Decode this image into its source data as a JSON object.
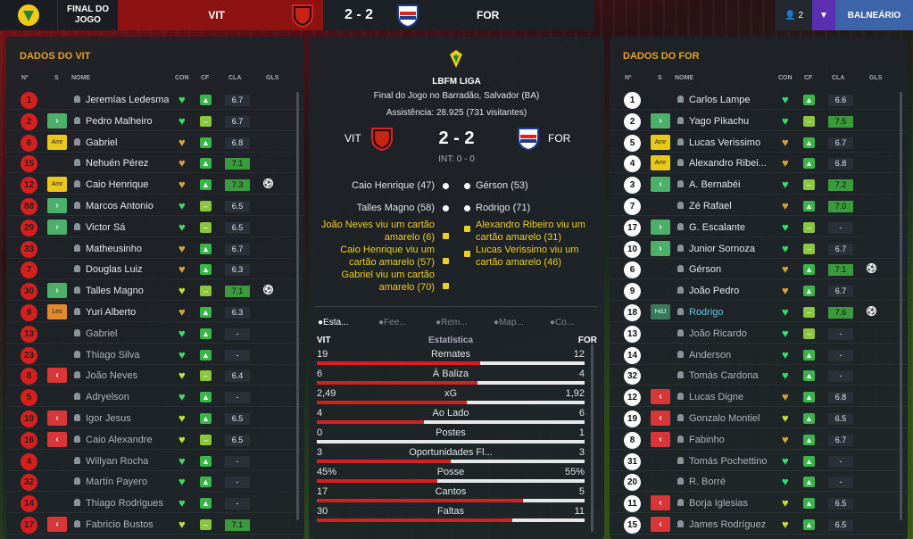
{
  "top": {
    "state": "FINAL DO JOGO",
    "home": "VIT",
    "away": "FOR",
    "score": "2 - 2",
    "users": "2",
    "locker": "BALNEÁRIO"
  },
  "vit": {
    "title": "DADOS DO VIT",
    "cols": [
      "Nº",
      "S",
      "NOME",
      "CON",
      "CF",
      "CLA",
      "GLS"
    ],
    "players": [
      {
        "n": "1",
        "s": "",
        "name": "Jeremías Ledesma",
        "h": "g",
        "cf": "ok",
        "cla": "6.7",
        "g": 0,
        "dim": 0
      },
      {
        "n": "2",
        "s": "in",
        "name": "Pedro Malheiro",
        "h": "g",
        "cf": "dash",
        "cla": "6.7",
        "g": 0,
        "dim": 0
      },
      {
        "n": "6",
        "s": "amr",
        "sl": "Amr",
        "name": "Gabriel",
        "h": "o",
        "cf": "ok",
        "cla": "6.8",
        "g": 0,
        "dim": 0
      },
      {
        "n": "15",
        "s": "",
        "name": "Nehuén Pérez",
        "h": "o",
        "cf": "ok",
        "cla": "7.1",
        "g": 0,
        "hi": 1,
        "dim": 0
      },
      {
        "n": "12",
        "s": "amr",
        "sl": "Amr",
        "name": "Caio Henrique",
        "h": "o",
        "cf": "ok",
        "cla": "7.3",
        "g": 1,
        "hi": 1,
        "dim": 0
      },
      {
        "n": "88",
        "s": "in",
        "name": "Marcos Antonio",
        "h": "g",
        "cf": "dash",
        "cla": "6.5",
        "g": 0,
        "dim": 0
      },
      {
        "n": "29",
        "s": "in",
        "name": "Victor Sá",
        "h": "g",
        "cf": "dash",
        "cla": "6.5",
        "g": 0,
        "dim": 0
      },
      {
        "n": "33",
        "s": "",
        "name": "Matheusinho",
        "h": "o",
        "cf": "ok",
        "cla": "6.7",
        "g": 0,
        "dim": 0
      },
      {
        "n": "7",
        "s": "",
        "name": "Douglas Luiz",
        "h": "o",
        "cf": "ok",
        "cla": "6.3",
        "g": 0,
        "dim": 0
      },
      {
        "n": "30",
        "s": "in",
        "name": "Talles Magno",
        "h": "y",
        "cf": "dash",
        "cla": "7.1",
        "g": 1,
        "hi": 1,
        "dim": 0
      },
      {
        "n": "9",
        "s": "les",
        "sl": "Les",
        "name": "Yuri Alberto",
        "h": "o",
        "cf": "ok",
        "cla": "6.3",
        "g": 0,
        "dim": 0
      },
      {
        "n": "13",
        "s": "",
        "name": "Gabriel",
        "h": "g",
        "cf": "ok",
        "cla": "-",
        "g": 0,
        "dim": 1
      },
      {
        "n": "23",
        "s": "",
        "name": "Thiago Silva",
        "h": "g",
        "cf": "ok",
        "cla": "-",
        "g": 0,
        "dim": 1
      },
      {
        "n": "8",
        "s": "out",
        "name": "João Neves",
        "h": "y",
        "cf": "dash",
        "cla": "6.4",
        "g": 0,
        "dim": 1
      },
      {
        "n": "5",
        "s": "",
        "name": "Adryelson",
        "h": "g",
        "cf": "ok",
        "cla": "-",
        "g": 0,
        "dim": 1
      },
      {
        "n": "10",
        "s": "out",
        "name": "Igor Jesus",
        "h": "y",
        "cf": "ok",
        "cla": "6.5",
        "g": 0,
        "dim": 1
      },
      {
        "n": "16",
        "s": "out",
        "name": "Caio Alexandre",
        "h": "y",
        "cf": "dash",
        "cla": "6.5",
        "g": 0,
        "dim": 1
      },
      {
        "n": "4",
        "s": "",
        "name": "Willyan Rocha",
        "h": "g",
        "cf": "ok",
        "cla": "-",
        "g": 0,
        "dim": 1
      },
      {
        "n": "32",
        "s": "",
        "name": "Martín Payero",
        "h": "g",
        "cf": "ok",
        "cla": "-",
        "g": 0,
        "dim": 1
      },
      {
        "n": "14",
        "s": "",
        "name": "Thiago Rodrigues",
        "h": "g",
        "cf": "ok",
        "cla": "-",
        "g": 0,
        "dim": 1
      },
      {
        "n": "17",
        "s": "out",
        "name": "Fabricio Bustos",
        "h": "y",
        "cf": "dash",
        "cla": "7.1",
        "g": 0,
        "hi": 1,
        "dim": 1
      }
    ]
  },
  "for": {
    "title": "DADOS DO FOR",
    "cols": [
      "Nº",
      "S",
      "NOME",
      "CON",
      "CF",
      "CLA",
      "GLS"
    ],
    "players": [
      {
        "n": "1",
        "s": "",
        "name": "Carlos Lampe",
        "h": "g",
        "cf": "ok",
        "cla": "6.6",
        "g": 0,
        "dim": 0
      },
      {
        "n": "2",
        "s": "in",
        "name": "Yago Pikachu",
        "h": "g",
        "cf": "dash",
        "cla": "7.5",
        "g": 0,
        "hi": 1,
        "dim": 0
      },
      {
        "n": "5",
        "s": "amr",
        "sl": "Amr",
        "name": "Lucas Verissimo",
        "h": "o",
        "cf": "ok",
        "cla": "6.7",
        "g": 0,
        "dim": 0
      },
      {
        "n": "4",
        "s": "amr",
        "sl": "Amr",
        "name": "Alexandro Ribei...",
        "h": "o",
        "cf": "ok",
        "cla": "6.8",
        "g": 0,
        "dim": 0
      },
      {
        "n": "3",
        "s": "in",
        "name": "A. Bernabéi",
        "h": "g",
        "cf": "dash",
        "cla": "7.2",
        "g": 0,
        "hi": 1,
        "dim": 0
      },
      {
        "n": "7",
        "s": "",
        "name": "Zé Rafael",
        "h": "o",
        "cf": "ok",
        "cla": "7.0",
        "g": 0,
        "hi": 1,
        "dim": 0
      },
      {
        "n": "17",
        "s": "in",
        "name": "G. Escalante",
        "h": "g",
        "cf": "dash",
        "cla": "-",
        "g": 0,
        "dim": 0
      },
      {
        "n": "10",
        "s": "in",
        "name": "Junior Sornoza",
        "h": "g",
        "cf": "dash",
        "cla": "6.7",
        "g": 0,
        "dim": 0
      },
      {
        "n": "6",
        "s": "",
        "name": "Gérson",
        "h": "o",
        "cf": "ok",
        "cla": "7.1",
        "g": 1,
        "hi": 1,
        "dim": 0
      },
      {
        "n": "9",
        "s": "",
        "name": "João Pedro",
        "h": "o",
        "cf": "ok",
        "cla": "6.7",
        "g": 0,
        "dim": 0
      },
      {
        "n": "18",
        "s": "hdj",
        "sl": "HdJ",
        "name": "Rodrigo",
        "h": "g",
        "cf": "dash",
        "cla": "7.6",
        "g": 1,
        "hi": 1,
        "link": 1,
        "dim": 0
      },
      {
        "n": "13",
        "s": "",
        "name": "João Ricardo",
        "h": "g",
        "cf": "dash",
        "cla": "-",
        "g": 0,
        "dim": 1
      },
      {
        "n": "14",
        "s": "",
        "name": "Anderson",
        "h": "g",
        "cf": "ok",
        "cla": "-",
        "g": 0,
        "dim": 1
      },
      {
        "n": "32",
        "s": "",
        "name": "Tomás Cardona",
        "h": "g",
        "cf": "ok",
        "cla": "-",
        "g": 0,
        "dim": 1
      },
      {
        "n": "12",
        "s": "out",
        "name": "Lucas Digne",
        "h": "o",
        "cf": "ok",
        "cla": "6.8",
        "g": 0,
        "dim": 1
      },
      {
        "n": "19",
        "s": "out",
        "name": "Gonzalo Montiel",
        "h": "y",
        "cf": "ok",
        "cla": "6.5",
        "g": 0,
        "dim": 1
      },
      {
        "n": "8",
        "s": "out",
        "name": "Fabinho",
        "h": "o",
        "cf": "ok",
        "cla": "6.7",
        "g": 0,
        "dim": 1
      },
      {
        "n": "31",
        "s": "",
        "name": "Tomás Pochettino",
        "h": "g",
        "cf": "ok",
        "cla": "-",
        "g": 0,
        "dim": 1
      },
      {
        "n": "20",
        "s": "",
        "name": "R. Borré",
        "h": "g",
        "cf": "ok",
        "cla": "-",
        "g": 0,
        "dim": 1
      },
      {
        "n": "11",
        "s": "out",
        "name": "Borja Iglesias",
        "h": "y",
        "cf": "ok",
        "cla": "6.5",
        "g": 0,
        "dim": 1
      },
      {
        "n": "15",
        "s": "out",
        "name": "James Rodríguez",
        "h": "y",
        "cf": "ok",
        "cla": "6.5",
        "g": 0,
        "dim": 1
      }
    ]
  },
  "match": {
    "league": "LBFM LIGA",
    "venue": "Final do Jogo no Barradão, Salvador (BA)",
    "attendance": "Assistência: 28.925 (731 visitantes)",
    "home": "VIT",
    "away": "FOR",
    "score": "2 - 2",
    "ht": "INT: 0 - 0",
    "home_events": [
      "Caio Henrique (47)",
      "Talles Magno (58)",
      "João Neves viu um cartão amarelo (6)",
      "Caio Henrique viu um cartão amarelo (57)",
      "Gabriel viu um cartão amarelo (70)"
    ],
    "away_events": [
      "Gérson (53)",
      "Rodrigo (71)",
      "Alexandro Ribeiro viu um cartão amarelo (31)",
      "Lucas Verissimo viu um cartão amarelo (46)"
    ],
    "tabs": [
      "Esta...",
      "Fee...",
      "Rem...",
      "Map...",
      "Co..."
    ],
    "stats_title": "Estatística",
    "stats": [
      {
        "label": "Remates",
        "home": "19",
        "away": "12",
        "share": 0.61
      },
      {
        "label": "À Baliza",
        "home": "6",
        "away": "4",
        "share": 0.6
      },
      {
        "label": "xG",
        "home": "2,49",
        "away": "1,92",
        "share": 0.56
      },
      {
        "label": "Ao Lado",
        "home": "4",
        "away": "6",
        "share": 0.4
      },
      {
        "label": "Postes",
        "home": "0",
        "away": "1",
        "share": 0.0
      },
      {
        "label": "Oportunidades Fl...",
        "home": "3",
        "away": "3",
        "share": 0.5
      },
      {
        "label": "Posse",
        "home": "45%",
        "away": "55%",
        "share": 0.45
      },
      {
        "label": "Cantos",
        "home": "17",
        "away": "5",
        "share": 0.77
      },
      {
        "label": "Faltas",
        "home": "30",
        "away": "11",
        "share": 0.73
      }
    ]
  }
}
